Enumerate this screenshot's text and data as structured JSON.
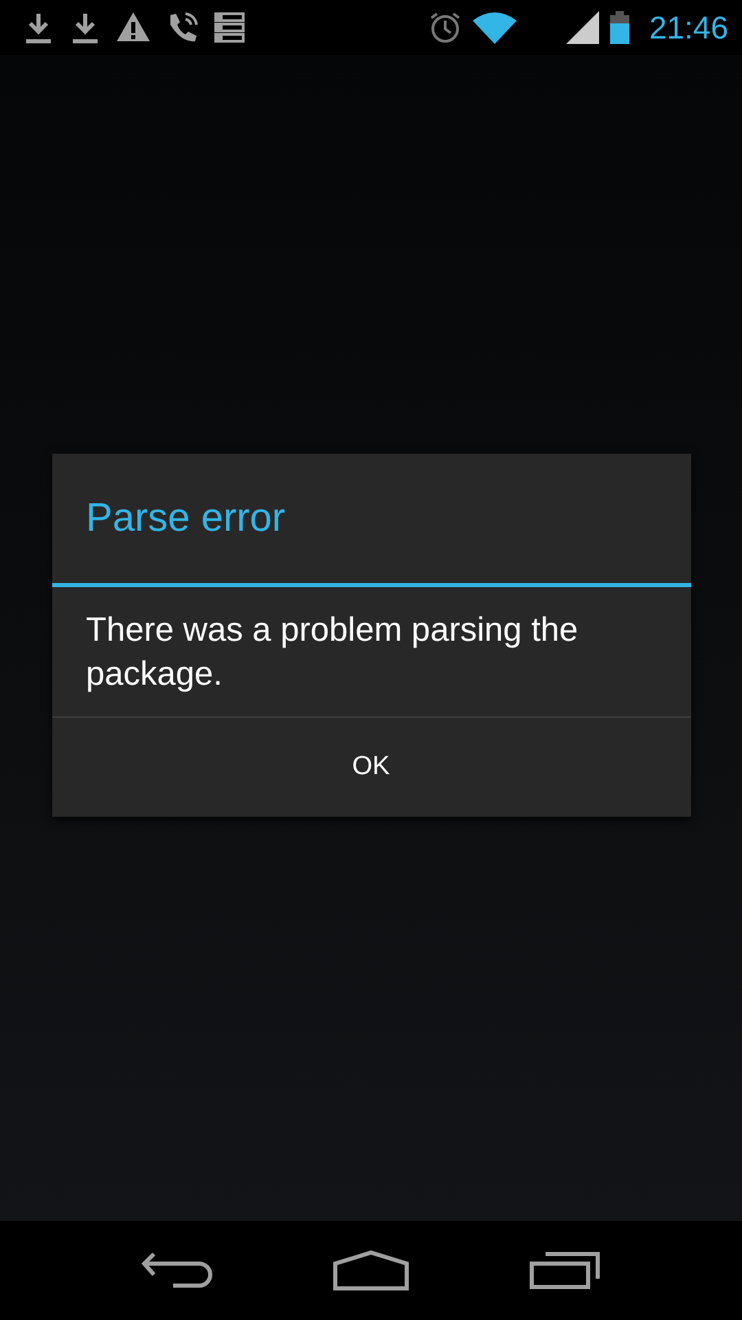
{
  "status_bar": {
    "time": "21:46"
  },
  "dialog": {
    "title": "Parse error",
    "message": "There was a problem parsing the package.",
    "buttons": [
      "OK"
    ]
  }
}
